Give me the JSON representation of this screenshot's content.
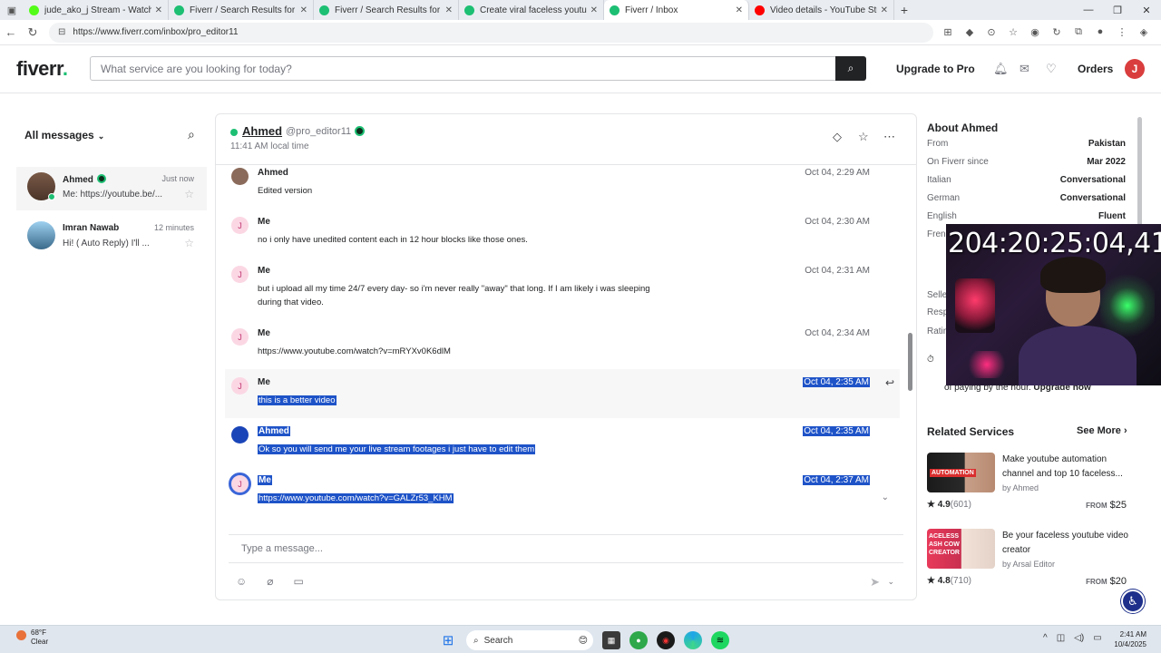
{
  "browser": {
    "tabs": [
      {
        "title": "jude_ako_j Stream - Watch Live o...",
        "color": "#53fc18"
      },
      {
        "title": "Fiverr / Search Results for 'youtub...",
        "color": "#1dbf73"
      },
      {
        "title": "Fiverr / Search Results for 'make a...",
        "color": "#1dbf73"
      },
      {
        "title": "Create viral faceless youtube vide...",
        "color": "#1dbf73"
      },
      {
        "title": "Fiverr / Inbox",
        "color": "#1dbf73"
      },
      {
        "title": "Video details - YouTube Studio",
        "color": "#ff0000"
      }
    ],
    "url": "https://www.fiverr.com/inbox/pro_editor11"
  },
  "header": {
    "logo": "fiverr",
    "logo_dot": ".",
    "search_placeholder": "What service are you looking for today?",
    "upgrade": "Upgrade to Pro",
    "orders": "Orders",
    "avatar": "J"
  },
  "inbox": {
    "filter_label": "All messages",
    "conversations": [
      {
        "name": "Ahmed",
        "time": "Just now",
        "preview": "Me: https://youtube.be/..."
      },
      {
        "name": "Imran Nawab",
        "time": "12 minutes",
        "preview": "Hi! ( Auto Reply) I'll ..."
      }
    ]
  },
  "chat": {
    "name": "Ahmed",
    "username": "@pro_editor11",
    "local_time": "11:41 AM local time",
    "messages": [
      {
        "sender": "Ahmed",
        "avatar": "",
        "time": "Oct 04, 2:29 AM",
        "text": "Edited version"
      },
      {
        "sender": "Me",
        "avatar": "J",
        "time": "Oct 04, 2:30 AM",
        "text": "no i only have unedited content each in 12 hour blocks like those ones."
      },
      {
        "sender": "Me",
        "avatar": "J",
        "time": "Oct 04, 2:31 AM",
        "text": "but i upload all my time 24/7  every day- so i'm never really \"away\" that long. If I am likely i was sleeping during that video."
      },
      {
        "sender": "Me",
        "avatar": "J",
        "time": "Oct 04, 2:34 AM",
        "text": "https://www.youtube.com/watch?v=mRYXv0K6dlM"
      },
      {
        "sender": "Me",
        "avatar": "J",
        "time": "Oct 04, 2:35 AM",
        "text": "this is a better video"
      },
      {
        "sender": "Ahmed",
        "avatar": "",
        "time": "Oct 04, 2:35 AM",
        "text": "Ok so you will send me your live stream footages i just have to edit them"
      },
      {
        "sender": "Me",
        "avatar": "J",
        "time": "Oct 04, 2:37 AM",
        "text": "https://www.youtube.com/watch?v=GALZr53_KHM"
      }
    ],
    "compose_placeholder": "Type a message..."
  },
  "about": {
    "title": "About Ahmed",
    "rows": [
      {
        "k": "From",
        "v": "Pakistan"
      },
      {
        "k": "On Fiverr since",
        "v": "Mar 2022"
      },
      {
        "k": "Italian",
        "v": "Conversational"
      },
      {
        "k": "German",
        "v": "Conversational"
      },
      {
        "k": "English",
        "v": "Fluent"
      }
    ],
    "partials": [
      "Fren",
      "Selle",
      "Resp",
      "Ratin"
    ],
    "pay_text": "of paying by the hour.",
    "pay_link": "Upgrade now"
  },
  "related": {
    "title": "Related Services",
    "see_more": "See More",
    "services": [
      {
        "title": "Make youtube automation channel and top 10 faceless...",
        "by": "by Ahmed",
        "rating": "4.9",
        "count": "(601)",
        "from": "FROM",
        "price": "$25",
        "thumb_text": "AUTOMATION"
      },
      {
        "title": "Be your faceless youtube video creator",
        "by": "by Arsal Editor",
        "rating": "4.8",
        "count": "(710)",
        "from": "FROM",
        "price": "$20",
        "thumb_text": "ACELESS ASH COW CREATOR"
      }
    ]
  },
  "stream": {
    "timer": "204:20:25:04,41"
  },
  "taskbar": {
    "temp": "68°F",
    "condition": "Clear",
    "search": "Search",
    "time": "2:41 AM",
    "date": "10/4/2025"
  }
}
